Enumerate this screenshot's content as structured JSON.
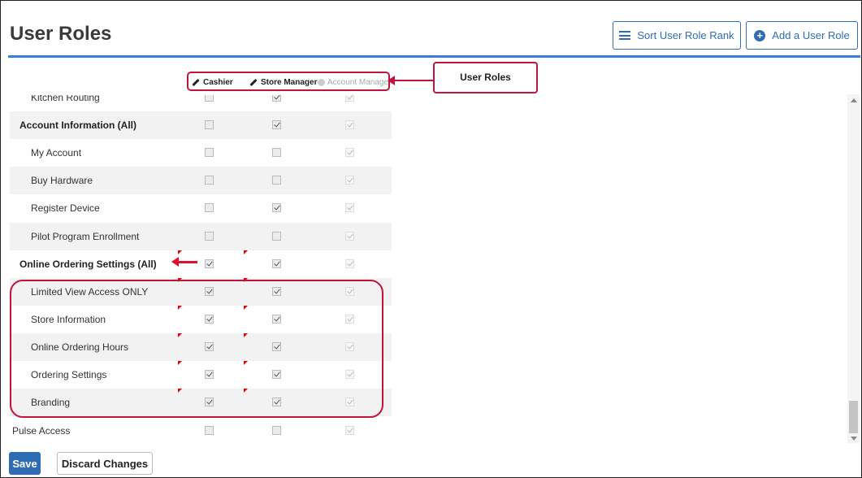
{
  "page": {
    "title": "User Roles"
  },
  "header": {
    "sort_label": "Sort User Role Rank",
    "add_label": "Add a User Role"
  },
  "columns": [
    {
      "label": "Cashier",
      "editable": true
    },
    {
      "label": "Store Manager",
      "editable": true
    },
    {
      "label": "Account Manager",
      "editable": false
    }
  ],
  "annotations": {
    "callout_label": "User Roles"
  },
  "rows": [
    {
      "label": "Kitchen Routing",
      "bold": false,
      "indent": true,
      "cashier": false,
      "store_manager": true,
      "account_manager": true
    },
    {
      "label": "Account Information (All)",
      "bold": true,
      "indent": false,
      "cashier": false,
      "store_manager": true,
      "account_manager": true
    },
    {
      "label": "My Account",
      "bold": false,
      "indent": true,
      "cashier": false,
      "store_manager": false,
      "account_manager": true
    },
    {
      "label": "Buy Hardware",
      "bold": false,
      "indent": true,
      "cashier": false,
      "store_manager": false,
      "account_manager": true
    },
    {
      "label": "Register Device",
      "bold": false,
      "indent": true,
      "cashier": false,
      "store_manager": true,
      "account_manager": true
    },
    {
      "label": "Pilot Program Enrollment",
      "bold": false,
      "indent": true,
      "cashier": false,
      "store_manager": false,
      "account_manager": true
    },
    {
      "label": "Online Ordering Settings (All)",
      "bold": true,
      "indent": false,
      "cashier": true,
      "store_manager": true,
      "account_manager": true
    },
    {
      "label": "Limited View Access ONLY",
      "bold": false,
      "indent": true,
      "cashier": true,
      "store_manager": true,
      "account_manager": true
    },
    {
      "label": "Store Information",
      "bold": false,
      "indent": true,
      "cashier": true,
      "store_manager": true,
      "account_manager": true
    },
    {
      "label": "Online Ordering Hours",
      "bold": false,
      "indent": true,
      "cashier": true,
      "store_manager": true,
      "account_manager": true
    },
    {
      "label": "Ordering Settings",
      "bold": false,
      "indent": true,
      "cashier": true,
      "store_manager": true,
      "account_manager": true
    },
    {
      "label": "Branding",
      "bold": false,
      "indent": true,
      "cashier": true,
      "store_manager": true,
      "account_manager": true
    }
  ],
  "pulse_row": {
    "label": "Pulse Access",
    "cashier": false,
    "store_manager": false,
    "account_manager": true
  },
  "footer": {
    "save_label": "Save",
    "discard_label": "Discard Changes"
  },
  "colors": {
    "accent": "#2e6db4",
    "annotation": "#c0143c",
    "header_line": "#3b7dd8"
  }
}
